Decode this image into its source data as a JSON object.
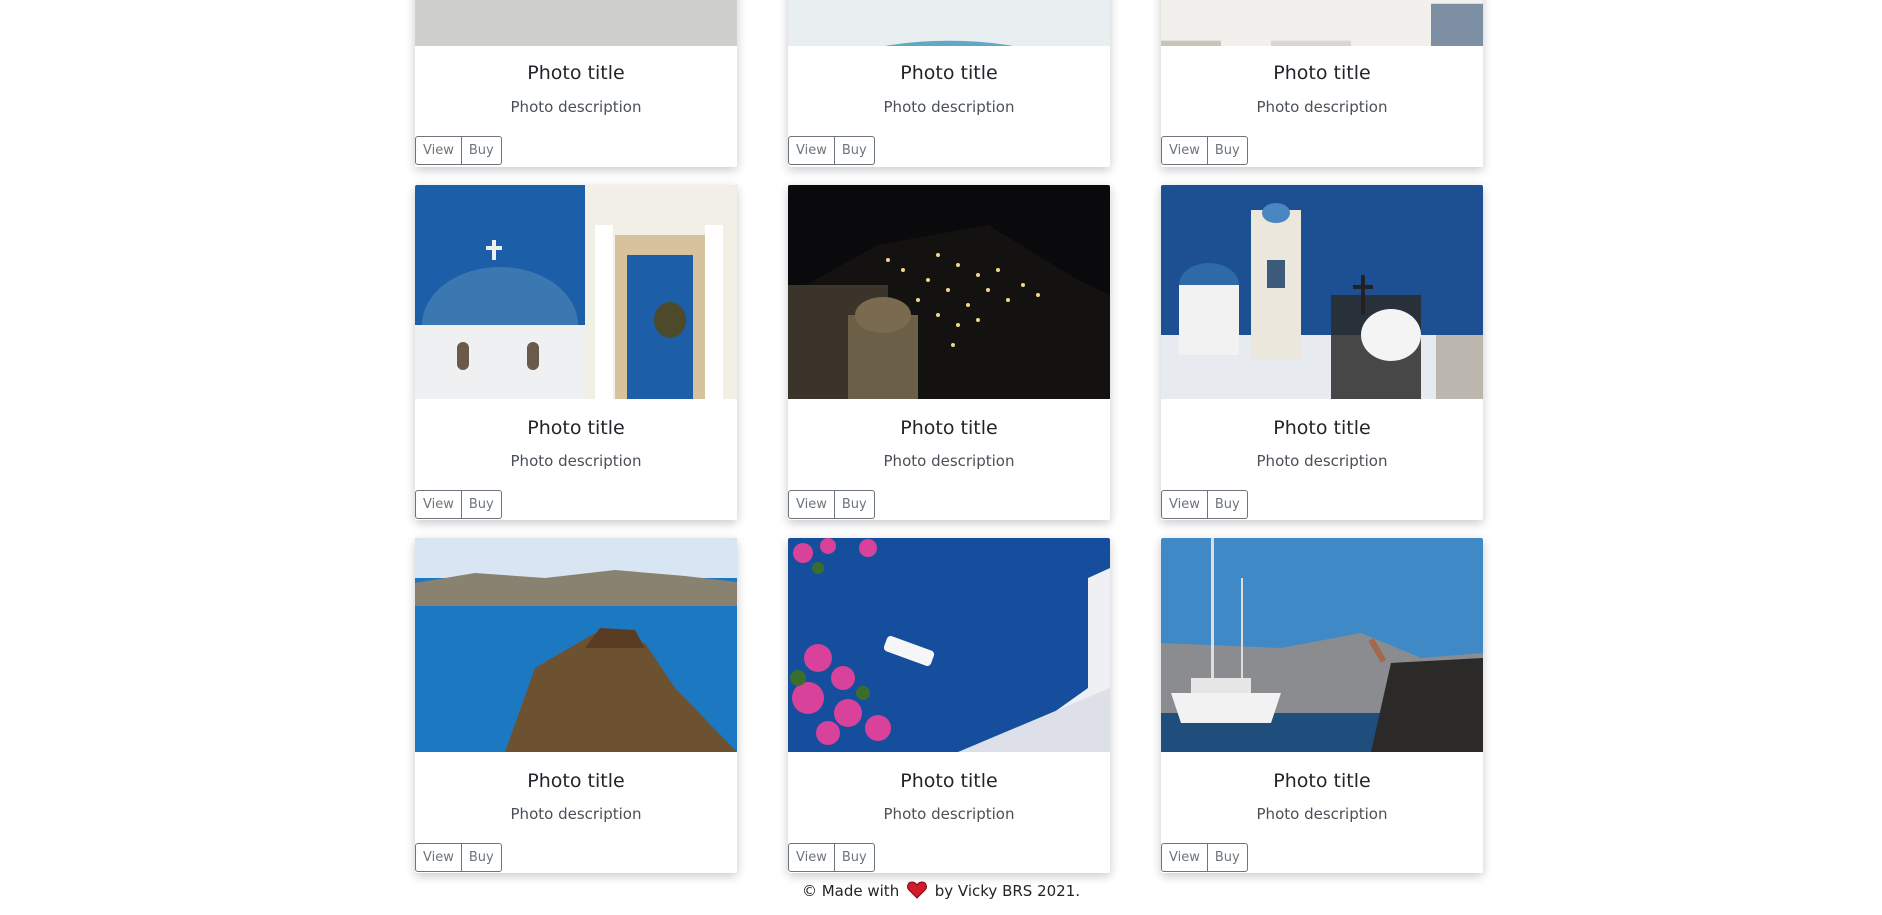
{
  "cards": [
    {
      "title": "Photo title",
      "description": "Photo description",
      "view_label": "View",
      "buy_label": "Buy"
    },
    {
      "title": "Photo title",
      "description": "Photo description",
      "view_label": "View",
      "buy_label": "Buy"
    },
    {
      "title": "Photo title",
      "description": "Photo description",
      "view_label": "View",
      "buy_label": "Buy"
    },
    {
      "title": "Photo title",
      "description": "Photo description",
      "view_label": "View",
      "buy_label": "Buy"
    },
    {
      "title": "Photo title",
      "description": "Photo description",
      "view_label": "View",
      "buy_label": "Buy"
    },
    {
      "title": "Photo title",
      "description": "Photo description",
      "view_label": "View",
      "buy_label": "Buy"
    },
    {
      "title": "Photo title",
      "description": "Photo description",
      "view_label": "View",
      "buy_label": "Buy"
    },
    {
      "title": "Photo title",
      "description": "Photo description",
      "view_label": "View",
      "buy_label": "Buy"
    },
    {
      "title": "Photo title",
      "description": "Photo description",
      "view_label": "View",
      "buy_label": "Buy"
    }
  ],
  "footer": {
    "copyright": "© Made with",
    "heart_icon": "heart-icon",
    "heart_color": "#d11a2a",
    "author": "by Vicky BRS 2021."
  },
  "colors": {
    "button_border": "#6c757d",
    "background": "#ffffff"
  }
}
